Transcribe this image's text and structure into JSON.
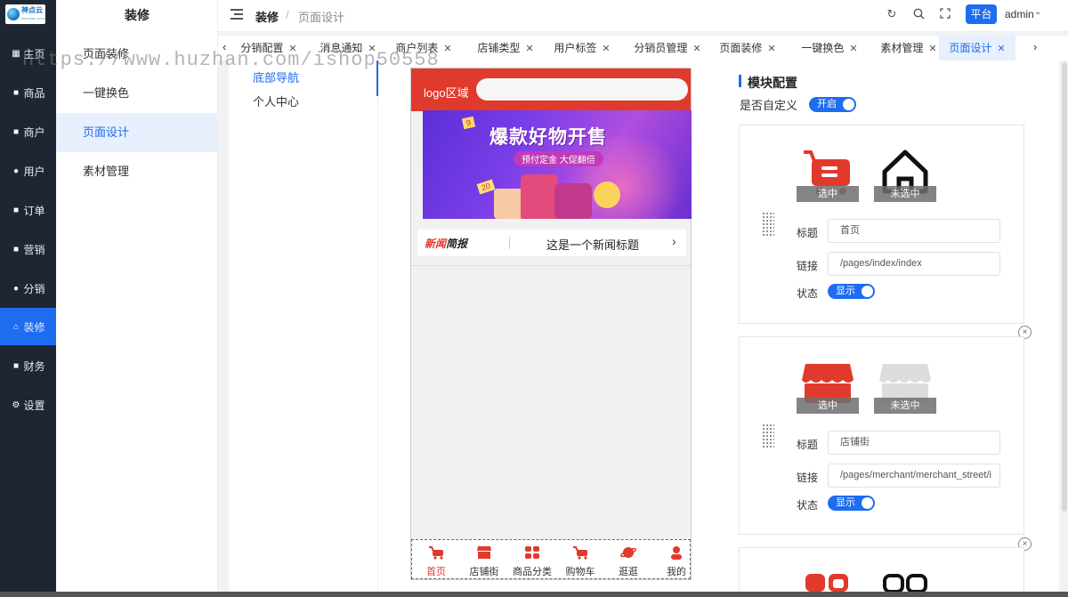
{
  "brand": {
    "logo_text": "神点云",
    "logo_sub": "shendian cloud"
  },
  "sidebar": {
    "items": [
      {
        "icon": "grid-icon",
        "glyph": "▦",
        "label": "主页"
      },
      {
        "icon": "bag-icon",
        "glyph": "■",
        "label": "商品"
      },
      {
        "icon": "store-icon",
        "glyph": "■",
        "label": "商户"
      },
      {
        "icon": "user-icon",
        "glyph": "●",
        "label": "用户"
      },
      {
        "icon": "order-icon",
        "glyph": "■",
        "label": "订单"
      },
      {
        "icon": "chart-icon",
        "glyph": "■",
        "label": "营销"
      },
      {
        "icon": "share-icon",
        "glyph": "●",
        "label": "分销"
      },
      {
        "icon": "home-icon",
        "glyph": "⌂",
        "label": "装修"
      },
      {
        "icon": "wallet-icon",
        "glyph": "■",
        "label": "财务"
      },
      {
        "icon": "gear-icon",
        "glyph": "⚙",
        "label": "设置"
      }
    ],
    "active_index": 7
  },
  "submenu": {
    "title": "装修",
    "items": [
      "页面装修",
      "一键换色",
      "页面设计",
      "素材管理"
    ],
    "active_index": 2
  },
  "header": {
    "breadcrumb": [
      "装修",
      "页面设计"
    ],
    "platform_button": "平台",
    "user": "admin"
  },
  "tabs": {
    "items": [
      "分销配置",
      "消息通知",
      "商户列表",
      "店铺类型",
      "用户标签",
      "分销员管理",
      "页面装修",
      "一键换色",
      "素材管理",
      "页面设计"
    ],
    "active_index": 9
  },
  "pages": {
    "items": [
      "底部导航",
      "个人中心"
    ],
    "active_index": 0
  },
  "watermark": "https://www.huzhan.com/ishop50558",
  "preview": {
    "logo_area": "logo区域",
    "banner_title": "爆款好物开售",
    "banner_subtitle": "预付定金 大促翻倍",
    "banner_tag1": "9",
    "banner_tag2": "20",
    "news_label_red": "新闻",
    "news_label_black": "简报",
    "news_title": "这是一个新闻标题",
    "tabbar": [
      {
        "label": "首页",
        "icon": "cart-icon",
        "selected": true
      },
      {
        "label": "店铺街",
        "icon": "shop-icon",
        "selected": false
      },
      {
        "label": "商品分类",
        "icon": "category-icon",
        "selected": false
      },
      {
        "label": "购物车",
        "icon": "cart-icon",
        "selected": false
      },
      {
        "label": "逛逛",
        "icon": "planet-icon",
        "selected": false
      },
      {
        "label": "我的",
        "icon": "person-icon",
        "selected": false
      }
    ],
    "colors": {
      "accent": "#e03a2c",
      "primary": "#1e6cf0"
    }
  },
  "config": {
    "title": "模块配置",
    "custom_label": "是否自定义",
    "custom_switch": "开启",
    "field_labels": {
      "title": "标题",
      "link": "链接",
      "status": "状态"
    },
    "selected_caption": "选中",
    "unselected_caption": "未选中",
    "modules": [
      {
        "title": "首页",
        "link": "/pages/index/index",
        "status": "显示"
      },
      {
        "title": "店铺街",
        "link": "/pages/merchant/merchant_street/i",
        "status": "显示"
      }
    ]
  }
}
